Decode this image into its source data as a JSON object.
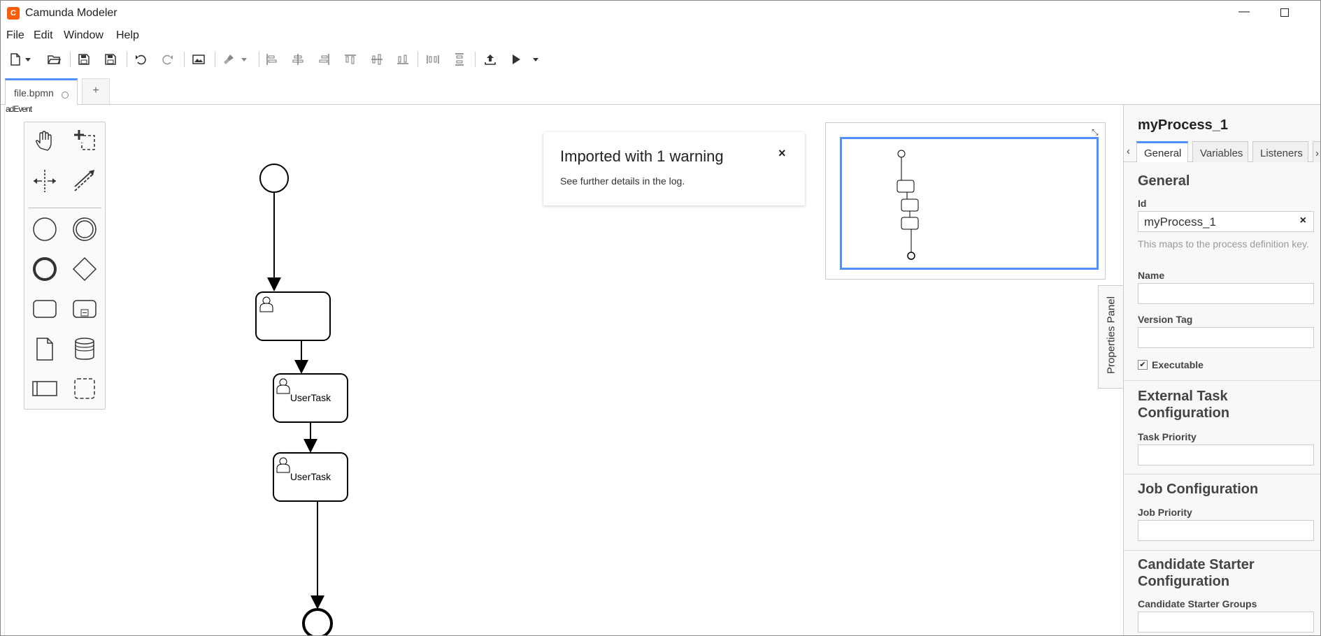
{
  "window": {
    "title": "Camunda Modeler",
    "logo_text": "C",
    "minimize": "—"
  },
  "menu": [
    "File",
    "Edit",
    "Window",
    "Help"
  ],
  "tabs": {
    "file_tab": "file.bpmn",
    "add_tab": "+"
  },
  "overlay_text": "adEvent",
  "toolbar_icons": [
    "new-file-icon",
    "open-folder-icon",
    "save-icon",
    "save-as-icon",
    "undo-icon",
    "redo-icon",
    "export-image-icon",
    "color-brush-icon",
    "align-left-icon",
    "align-center-icon",
    "align-right-icon",
    "align-top-icon",
    "align-middle-icon",
    "align-bottom-icon",
    "distribute-horizontal-icon",
    "distribute-vertical-icon",
    "deploy-icon",
    "start-instance-icon"
  ],
  "palette_icons": [
    "hand-tool-icon",
    "lasso-tool-icon",
    "space-tool-icon",
    "connect-tool-icon",
    "start-event-icon",
    "intermediate-event-icon",
    "end-event-icon",
    "gateway-icon",
    "task-icon",
    "subprocess-icon",
    "data-object-icon",
    "data-store-icon",
    "participant-icon",
    "group-icon"
  ],
  "diagram": {
    "tasks": [
      {
        "label": ""
      },
      {
        "label": "UserTask"
      },
      {
        "label": "UserTask"
      }
    ]
  },
  "notification": {
    "title": "Imported with 1 warning",
    "body": "See further details in the log.",
    "close": "×"
  },
  "properties_toggle": "Properties Panel",
  "properties": {
    "title": "myProcess_1",
    "prev_tab": "‹",
    "next_tab": "›",
    "tabs": [
      "General",
      "Variables",
      "Listeners"
    ],
    "active_tab": "General",
    "section_general": "General",
    "id_label": "Id",
    "id_value": "myProcess_1",
    "id_clear": "×",
    "id_description": "This maps to the process definition key.",
    "name_label": "Name",
    "name_value": "",
    "version_tag_label": "Version Tag",
    "version_tag_value": "",
    "executable_label": "Executable",
    "executable_checked": true,
    "check_mark": "✔",
    "section_external": "External Task Configuration",
    "task_priority_label": "Task Priority",
    "section_job": "Job Configuration",
    "job_priority_label": "Job Priority",
    "section_starter": "Candidate Starter Configuration",
    "starter_groups_label": "Candidate Starter Groups"
  },
  "colors": {
    "accent": "#4d90fe",
    "logo": "#fc5d0d"
  }
}
